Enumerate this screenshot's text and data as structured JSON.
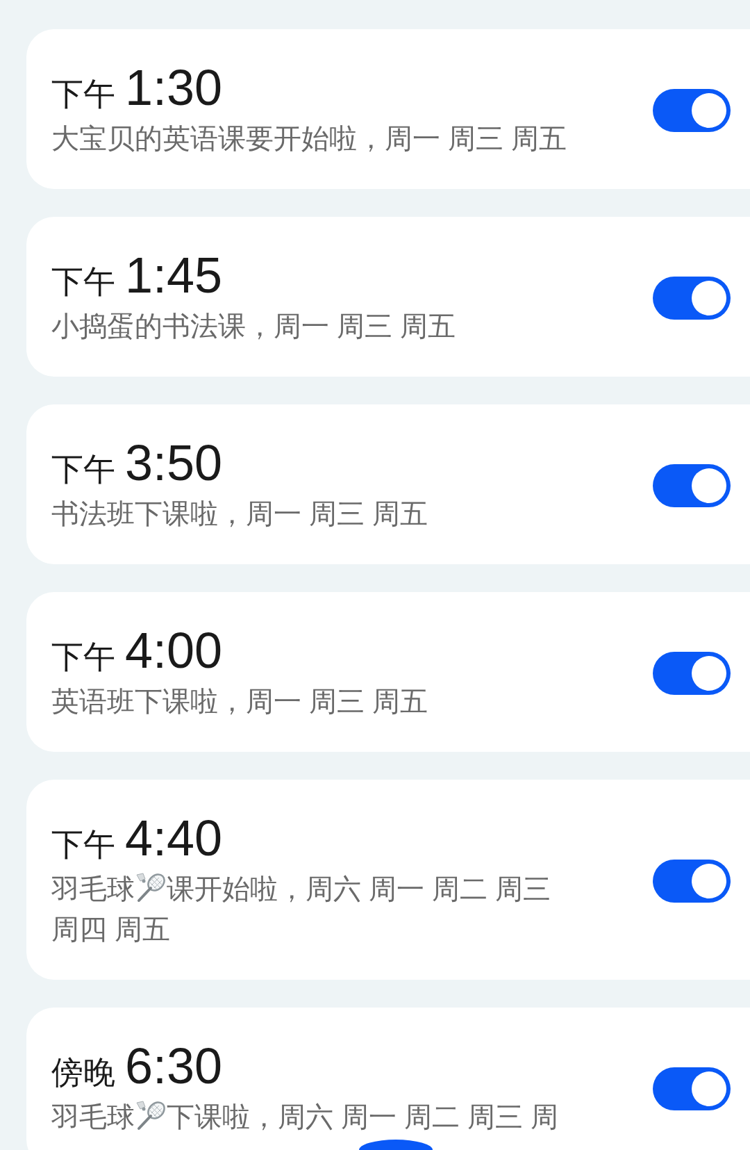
{
  "alarms": [
    {
      "period": "下午",
      "time": "1:30",
      "on": true,
      "lines": [
        {
          "parts": [
            {
              "kind": "text",
              "text": "大宝贝的英语课要开始啦，周一 周三 周五"
            }
          ]
        }
      ]
    },
    {
      "period": "下午",
      "time": "1:45",
      "on": true,
      "lines": [
        {
          "parts": [
            {
              "kind": "text",
              "text": "小捣蛋的书法课，周一 周三 周五"
            }
          ]
        }
      ]
    },
    {
      "period": "下午",
      "time": "3:50",
      "on": true,
      "lines": [
        {
          "parts": [
            {
              "kind": "text",
              "text": "书法班下课啦，周一 周三 周五"
            }
          ]
        }
      ]
    },
    {
      "period": "下午",
      "time": "4:00",
      "on": true,
      "lines": [
        {
          "parts": [
            {
              "kind": "text",
              "text": "英语班下课啦，周一 周三 周五"
            }
          ]
        }
      ]
    },
    {
      "period": "下午",
      "time": "4:40",
      "on": true,
      "lines": [
        {
          "parts": [
            {
              "kind": "text",
              "text": "羽毛球"
            },
            {
              "kind": "badminton"
            },
            {
              "kind": "text",
              "text": "课开始啦，周六 周一 周二 周三"
            }
          ]
        },
        {
          "parts": [
            {
              "kind": "text",
              "text": "周四 周五"
            }
          ]
        }
      ]
    },
    {
      "period": "傍晚",
      "time": "6:30",
      "on": true,
      "lines": [
        {
          "parts": [
            {
              "kind": "text",
              "text": "羽毛球"
            },
            {
              "kind": "badminton"
            },
            {
              "kind": "text",
              "text": "下课啦，周六 周一 周二 周三 周"
            }
          ]
        }
      ]
    }
  ]
}
